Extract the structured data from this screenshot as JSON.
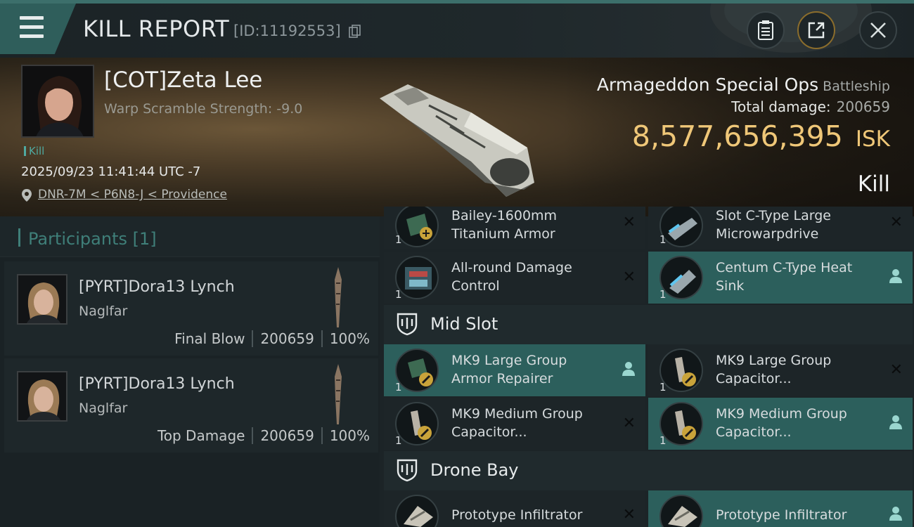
{
  "header": {
    "title": "KILL REPORT",
    "report_id": "[ID:11192553]"
  },
  "victim": {
    "pilot_name": "[COT]Zeta Lee",
    "warp_scramble": "Warp Scramble Strength: -9.0",
    "tag": "Kill",
    "datetime": "2025/09/23 11:41:44 UTC -7",
    "location": "DNR-7M < P6N8-J < Providence",
    "ship_name": "Armageddon Special Ops",
    "ship_class": "Battleship",
    "total_damage_label": "Total damage:",
    "total_damage_value": "200659",
    "isk_value": "8,577,656,395",
    "isk_unit": "ISK",
    "result": "Kill"
  },
  "participants": {
    "title": "Participants",
    "count": "[1]",
    "items": [
      {
        "name": "[PYRT]Dora13 Lynch",
        "ship": "Naglfar",
        "role": "Final Blow",
        "damage": "200659",
        "percent": "100%"
      },
      {
        "name": "[PYRT]Dora13 Lynch",
        "ship": "Naglfar",
        "role": "Top Damage",
        "damage": "200659",
        "percent": "100%"
      }
    ]
  },
  "fitting": {
    "low_slot_partial": [
      {
        "name_line1": "Bailey-1600mm",
        "name_line2": "Titanium Armor",
        "qty": "1",
        "status": "destroyed"
      },
      {
        "name_line1": "Slot C-Type Large",
        "name_line2": "Microwarpdrive",
        "qty": "1",
        "status": "destroyed"
      },
      {
        "name_line1": "All-round Damage",
        "name_line2": "Control",
        "qty": "1",
        "status": "destroyed"
      },
      {
        "name_line1": "Centum C-Type Heat",
        "name_line2": "Sink",
        "qty": "1",
        "status": "dropped"
      }
    ],
    "mid_slot": {
      "title": "Mid Slot",
      "items": [
        {
          "name_line1": "MK9 Large Group",
          "name_line2": "Armor Repairer",
          "qty": "1",
          "status": "dropped"
        },
        {
          "name_line1": "MK9 Large Group",
          "name_line2": "Capacitor...",
          "qty": "1",
          "status": "destroyed"
        },
        {
          "name_line1": "MK9 Medium Group",
          "name_line2": "Capacitor...",
          "qty": "1",
          "status": "destroyed"
        },
        {
          "name_line1": "MK9 Medium Group",
          "name_line2": "Capacitor...",
          "qty": "1",
          "status": "dropped"
        }
      ]
    },
    "drone_bay": {
      "title": "Drone Bay",
      "items": [
        {
          "name_line1": "Prototype Infiltrator",
          "qty": "1",
          "status": "destroyed"
        },
        {
          "name_line1": "Prototype Infiltrator",
          "qty": "1",
          "status": "dropped"
        }
      ]
    }
  },
  "icons": {
    "menu": "hamburger-menu-icon",
    "copy": "copy-icon",
    "clipboard": "clipboard-icon",
    "share": "share-icon",
    "close": "close-icon",
    "location": "location-pin-icon",
    "destroyed": "x-icon",
    "dropped": "person-icon"
  },
  "colors": {
    "accent_teal": "#2c5f5c",
    "isk_gold": "#efc778",
    "participants_teal": "#3f7f79"
  }
}
